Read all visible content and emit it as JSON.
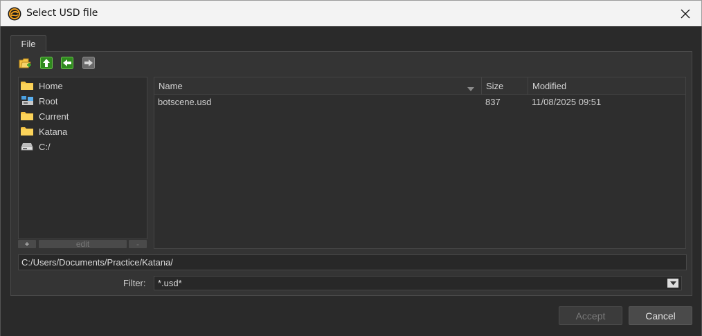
{
  "window": {
    "title": "Select USD file",
    "close_icon": "close-icon",
    "app_icon": "katana-logo-icon"
  },
  "tabs": [
    {
      "label": "File",
      "active": true
    }
  ],
  "toolbar": {
    "icons": [
      "new-folder-icon",
      "parent-folder-up-arrow-icon",
      "back-arrow-icon",
      "forward-arrow-icon"
    ],
    "forward_enabled": false
  },
  "places": {
    "items": [
      {
        "label": "Home",
        "icon": "folder-icon"
      },
      {
        "label": "Root",
        "icon": "network-root-icon"
      },
      {
        "label": "Current",
        "icon": "folder-icon"
      },
      {
        "label": "Katana",
        "icon": "folder-icon"
      },
      {
        "label": "C:/",
        "icon": "drive-icon"
      }
    ],
    "add_label": "+",
    "edit_label": "edit",
    "remove_label": "-"
  },
  "file_list": {
    "columns": [
      "Name",
      "Size",
      "Modified"
    ],
    "sort_icon": "sort-down-icon",
    "rows": [
      {
        "name": "botscene.usd",
        "size": "837",
        "modified": "11/08/2025 09:51"
      }
    ]
  },
  "path": {
    "value": "C:/Users/Documents/Practice/Katana/"
  },
  "filter": {
    "label": "Filter:",
    "value": "*.usd*",
    "dropdown_icon": "dropdown-arrow-icon"
  },
  "buttons": {
    "accept": "Accept",
    "cancel": "Cancel",
    "accept_enabled": false
  },
  "colors": {
    "folder": "#f7c545",
    "arrow_green": "#2f8a1e",
    "background": "#2b2b2b"
  }
}
